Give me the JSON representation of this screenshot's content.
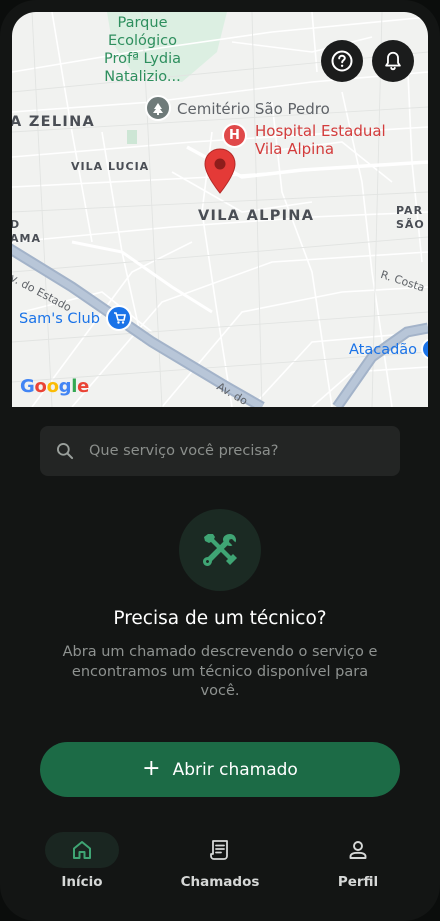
{
  "map": {
    "labels": {
      "park": "Parque\nEcológico\nProfª Lydia\nNatalizio...",
      "vila_zelina": "A ZELINA",
      "vila_lucia": "VILA LUCIA",
      "cemetery": "Cemitério São Pedro",
      "hospital": "Hospital Estadual\nVila Alpina",
      "vila_alpina": "VILA ALPINA",
      "right_district": "PAR\nSÃO L",
      "left_cut": "D\nAMA",
      "av_estado_top": "Av. do Estado",
      "sams_club": "Sam's Club",
      "costa": "R. Costa",
      "atacadao": "Atacadão",
      "av_bottom": "Av. do",
      "google": [
        "G",
        "o",
        "o",
        "g",
        "l",
        "e"
      ]
    },
    "google_colors": [
      "#4285F4",
      "#EA4335",
      "#FBBC05",
      "#4285F4",
      "#34A853",
      "#EA4335"
    ],
    "help_icon": "question-circle-icon",
    "notify_icon": "bell-icon"
  },
  "search": {
    "placeholder": "Que serviço você precisa?",
    "icon": "search-icon"
  },
  "empty_state": {
    "icon": "hammer-wrench-icon",
    "title": "Precisa de um técnico?",
    "description": "Abra um chamado descrevendo o serviço e encontramos um técnico disponível para você."
  },
  "cta": {
    "label": "Abrir chamado",
    "icon_glyph": "+"
  },
  "nav": {
    "items": [
      {
        "label": "Início",
        "icon": "home-icon",
        "active": true
      },
      {
        "label": "Chamados",
        "icon": "receipt-icon",
        "active": false
      },
      {
        "label": "Perfil",
        "icon": "person-icon",
        "active": false
      }
    ]
  },
  "colors": {
    "accent": "#1c6b46",
    "accent_icon": "#3fa574",
    "background": "#131514"
  }
}
